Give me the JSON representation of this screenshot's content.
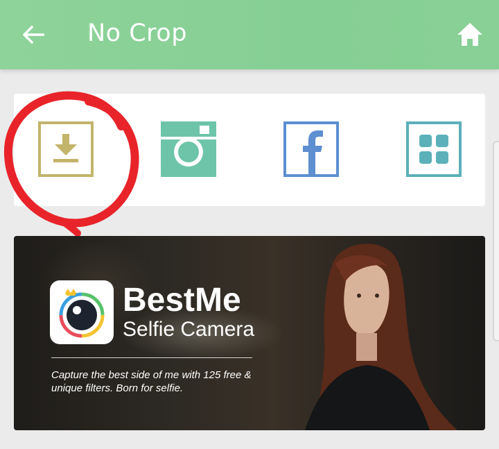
{
  "appbar": {
    "title": "No Crop",
    "back_icon": "arrow-left-icon",
    "home_icon": "home-icon",
    "color": "#8ad295"
  },
  "share_options": [
    {
      "name": "download",
      "icon": "download-icon",
      "color": "#c2b46a"
    },
    {
      "name": "instagram",
      "icon": "instagram-icon",
      "color": "#6ec4a8"
    },
    {
      "name": "facebook",
      "icon": "facebook-icon",
      "color": "#5d8fd1"
    },
    {
      "name": "more",
      "icon": "grid-icon",
      "color": "#5cb0b9"
    }
  ],
  "annotation": {
    "shape": "hand-drawn circle",
    "color": "#e8242a"
  },
  "ad": {
    "title": "BestMe",
    "subtitle": "Selfie Camera",
    "description": "Capture the best side of me with 125 free & unique filters. Born for selfie."
  }
}
